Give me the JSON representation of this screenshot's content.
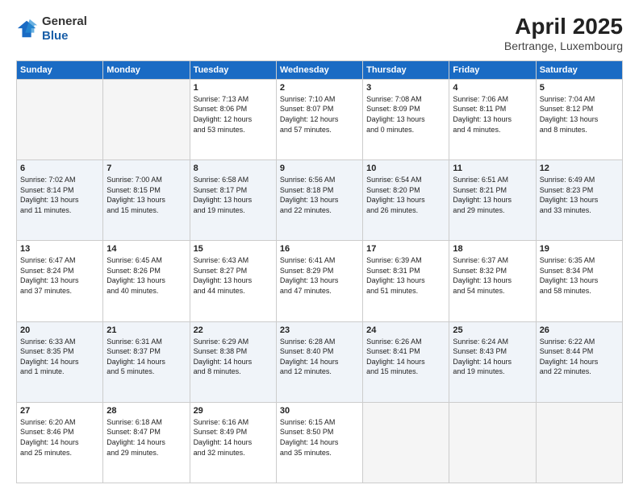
{
  "header": {
    "logo_line1": "General",
    "logo_line2": "Blue",
    "title": "April 2025",
    "subtitle": "Bertrange, Luxembourg"
  },
  "calendar": {
    "days_of_week": [
      "Sunday",
      "Monday",
      "Tuesday",
      "Wednesday",
      "Thursday",
      "Friday",
      "Saturday"
    ],
    "weeks": [
      [
        {
          "day": "",
          "info": ""
        },
        {
          "day": "",
          "info": ""
        },
        {
          "day": "1",
          "info": "Sunrise: 7:13 AM\nSunset: 8:06 PM\nDaylight: 12 hours\nand 53 minutes."
        },
        {
          "day": "2",
          "info": "Sunrise: 7:10 AM\nSunset: 8:07 PM\nDaylight: 12 hours\nand 57 minutes."
        },
        {
          "day": "3",
          "info": "Sunrise: 7:08 AM\nSunset: 8:09 PM\nDaylight: 13 hours\nand 0 minutes."
        },
        {
          "day": "4",
          "info": "Sunrise: 7:06 AM\nSunset: 8:11 PM\nDaylight: 13 hours\nand 4 minutes."
        },
        {
          "day": "5",
          "info": "Sunrise: 7:04 AM\nSunset: 8:12 PM\nDaylight: 13 hours\nand 8 minutes."
        }
      ],
      [
        {
          "day": "6",
          "info": "Sunrise: 7:02 AM\nSunset: 8:14 PM\nDaylight: 13 hours\nand 11 minutes."
        },
        {
          "day": "7",
          "info": "Sunrise: 7:00 AM\nSunset: 8:15 PM\nDaylight: 13 hours\nand 15 minutes."
        },
        {
          "day": "8",
          "info": "Sunrise: 6:58 AM\nSunset: 8:17 PM\nDaylight: 13 hours\nand 19 minutes."
        },
        {
          "day": "9",
          "info": "Sunrise: 6:56 AM\nSunset: 8:18 PM\nDaylight: 13 hours\nand 22 minutes."
        },
        {
          "day": "10",
          "info": "Sunrise: 6:54 AM\nSunset: 8:20 PM\nDaylight: 13 hours\nand 26 minutes."
        },
        {
          "day": "11",
          "info": "Sunrise: 6:51 AM\nSunset: 8:21 PM\nDaylight: 13 hours\nand 29 minutes."
        },
        {
          "day": "12",
          "info": "Sunrise: 6:49 AM\nSunset: 8:23 PM\nDaylight: 13 hours\nand 33 minutes."
        }
      ],
      [
        {
          "day": "13",
          "info": "Sunrise: 6:47 AM\nSunset: 8:24 PM\nDaylight: 13 hours\nand 37 minutes."
        },
        {
          "day": "14",
          "info": "Sunrise: 6:45 AM\nSunset: 8:26 PM\nDaylight: 13 hours\nand 40 minutes."
        },
        {
          "day": "15",
          "info": "Sunrise: 6:43 AM\nSunset: 8:27 PM\nDaylight: 13 hours\nand 44 minutes."
        },
        {
          "day": "16",
          "info": "Sunrise: 6:41 AM\nSunset: 8:29 PM\nDaylight: 13 hours\nand 47 minutes."
        },
        {
          "day": "17",
          "info": "Sunrise: 6:39 AM\nSunset: 8:31 PM\nDaylight: 13 hours\nand 51 minutes."
        },
        {
          "day": "18",
          "info": "Sunrise: 6:37 AM\nSunset: 8:32 PM\nDaylight: 13 hours\nand 54 minutes."
        },
        {
          "day": "19",
          "info": "Sunrise: 6:35 AM\nSunset: 8:34 PM\nDaylight: 13 hours\nand 58 minutes."
        }
      ],
      [
        {
          "day": "20",
          "info": "Sunrise: 6:33 AM\nSunset: 8:35 PM\nDaylight: 14 hours\nand 1 minute."
        },
        {
          "day": "21",
          "info": "Sunrise: 6:31 AM\nSunset: 8:37 PM\nDaylight: 14 hours\nand 5 minutes."
        },
        {
          "day": "22",
          "info": "Sunrise: 6:29 AM\nSunset: 8:38 PM\nDaylight: 14 hours\nand 8 minutes."
        },
        {
          "day": "23",
          "info": "Sunrise: 6:28 AM\nSunset: 8:40 PM\nDaylight: 14 hours\nand 12 minutes."
        },
        {
          "day": "24",
          "info": "Sunrise: 6:26 AM\nSunset: 8:41 PM\nDaylight: 14 hours\nand 15 minutes."
        },
        {
          "day": "25",
          "info": "Sunrise: 6:24 AM\nSunset: 8:43 PM\nDaylight: 14 hours\nand 19 minutes."
        },
        {
          "day": "26",
          "info": "Sunrise: 6:22 AM\nSunset: 8:44 PM\nDaylight: 14 hours\nand 22 minutes."
        }
      ],
      [
        {
          "day": "27",
          "info": "Sunrise: 6:20 AM\nSunset: 8:46 PM\nDaylight: 14 hours\nand 25 minutes."
        },
        {
          "day": "28",
          "info": "Sunrise: 6:18 AM\nSunset: 8:47 PM\nDaylight: 14 hours\nand 29 minutes."
        },
        {
          "day": "29",
          "info": "Sunrise: 6:16 AM\nSunset: 8:49 PM\nDaylight: 14 hours\nand 32 minutes."
        },
        {
          "day": "30",
          "info": "Sunrise: 6:15 AM\nSunset: 8:50 PM\nDaylight: 14 hours\nand 35 minutes."
        },
        {
          "day": "",
          "info": ""
        },
        {
          "day": "",
          "info": ""
        },
        {
          "day": "",
          "info": ""
        }
      ]
    ]
  }
}
